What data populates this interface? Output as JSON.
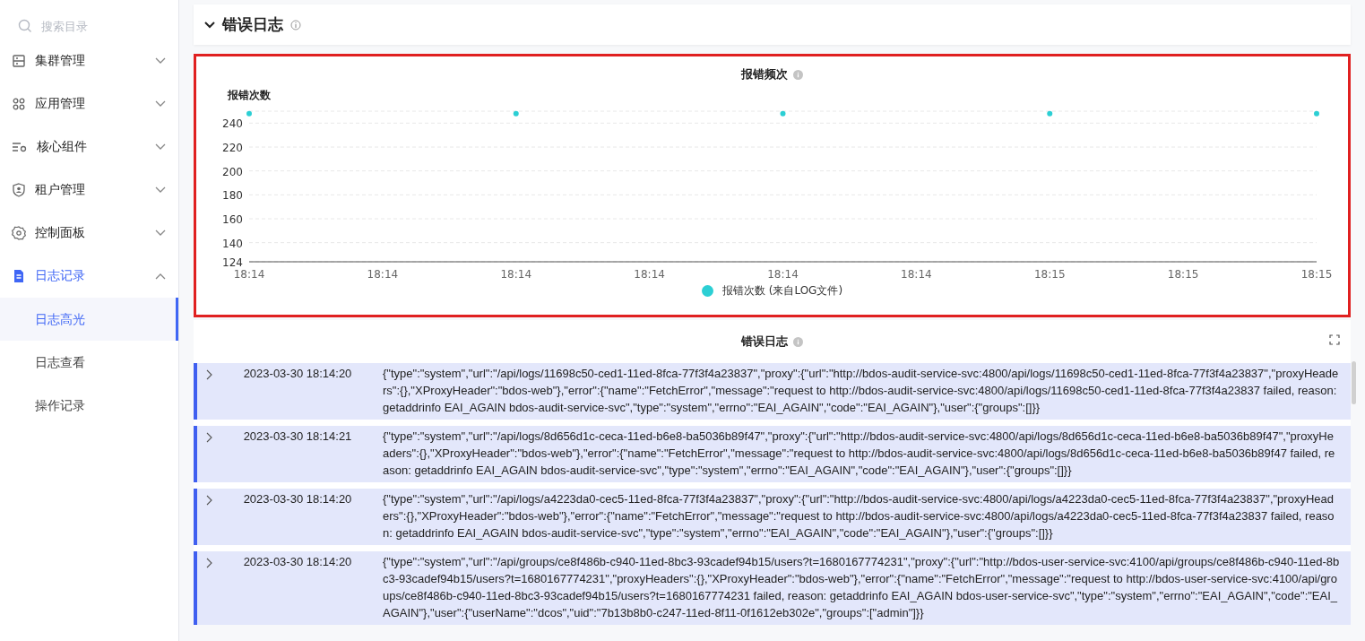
{
  "sidebar": {
    "search": {
      "placeholder": "搜索目录"
    },
    "items": [
      {
        "label": "集群管理",
        "expanded": false
      },
      {
        "label": "应用管理",
        "expanded": false
      },
      {
        "label": "核心组件",
        "expanded": false
      },
      {
        "label": "租户管理",
        "expanded": false
      },
      {
        "label": "控制面板",
        "expanded": false
      },
      {
        "label": "日志记录",
        "expanded": true,
        "children": [
          {
            "label": "日志高光",
            "selected": true
          },
          {
            "label": "日志查看",
            "selected": false
          },
          {
            "label": "操作记录",
            "selected": false
          }
        ]
      }
    ]
  },
  "section": {
    "title": "错误日志",
    "expanded": true
  },
  "chart_panel": {
    "title": "报错频次",
    "chart_data": {
      "type": "scatter",
      "grid": true,
      "ylabel": "报错次数",
      "categories": [
        "18:14",
        "18:14",
        "18:14",
        "18:14",
        "18:14",
        "18:14",
        "18:15",
        "18:15",
        "18:15"
      ],
      "ylim": [
        124,
        250
      ],
      "yticks": [
        124,
        140,
        160,
        180,
        200,
        220,
        240
      ],
      "series": [
        {
          "name": "报错次数 (来自LOG文件)",
          "color": "#2ccfd4",
          "values": [
            248,
            null,
            248,
            null,
            248,
            null,
            248,
            null,
            248
          ]
        }
      ]
    }
  },
  "log_panel": {
    "title": "错误日志",
    "rows": [
      {
        "expanded": false,
        "time": "2023-03-30 18:14:20",
        "message": "{\"type\":\"system\",\"url\":\"/api/logs/11698c50-ced1-11ed-8fca-77f3f4a23837\",\"proxy\":{\"url\":\"http://bdos-audit-service-svc:4800/api/logs/11698c50-ced1-11ed-8fca-77f3f4a23837\",\"proxyHeaders\":{},\"XProxyHeader\":\"bdos-web\"},\"error\":{\"name\":\"FetchError\",\"message\":\"request to http://bdos-audit-service-svc:4800/api/logs/11698c50-ced1-11ed-8fca-77f3f4a23837 failed, reason: getaddrinfo EAI_AGAIN bdos-audit-service-svc\",\"type\":\"system\",\"errno\":\"EAI_AGAIN\",\"code\":\"EAI_AGAIN\"},\"user\":{\"groups\":[]}}"
      },
      {
        "expanded": false,
        "time": "2023-03-30 18:14:21",
        "message": "{\"type\":\"system\",\"url\":\"/api/logs/8d656d1c-ceca-11ed-b6e8-ba5036b89f47\",\"proxy\":{\"url\":\"http://bdos-audit-service-svc:4800/api/logs/8d656d1c-ceca-11ed-b6e8-ba5036b89f47\",\"proxyHeaders\":{},\"XProxyHeader\":\"bdos-web\"},\"error\":{\"name\":\"FetchError\",\"message\":\"request to http://bdos-audit-service-svc:4800/api/logs/8d656d1c-ceca-11ed-b6e8-ba5036b89f47 failed, reason: getaddrinfo EAI_AGAIN bdos-audit-service-svc\",\"type\":\"system\",\"errno\":\"EAI_AGAIN\",\"code\":\"EAI_AGAIN\"},\"user\":{\"groups\":[]}}"
      },
      {
        "expanded": false,
        "time": "2023-03-30 18:14:20",
        "message": "{\"type\":\"system\",\"url\":\"/api/logs/a4223da0-cec5-11ed-8fca-77f3f4a23837\",\"proxy\":{\"url\":\"http://bdos-audit-service-svc:4800/api/logs/a4223da0-cec5-11ed-8fca-77f3f4a23837\",\"proxyHeaders\":{},\"XProxyHeader\":\"bdos-web\"},\"error\":{\"name\":\"FetchError\",\"message\":\"request to http://bdos-audit-service-svc:4800/api/logs/a4223da0-cec5-11ed-8fca-77f3f4a23837 failed, reason: getaddrinfo EAI_AGAIN bdos-audit-service-svc\",\"type\":\"system\",\"errno\":\"EAI_AGAIN\",\"code\":\"EAI_AGAIN\"},\"user\":{\"groups\":[]}}"
      },
      {
        "expanded": false,
        "time": "2023-03-30 18:14:20",
        "message": "{\"type\":\"system\",\"url\":\"/api/groups/ce8f486b-c940-11ed-8bc3-93cadef94b15/users?t=1680167774231\",\"proxy\":{\"url\":\"http://bdos-user-service-svc:4100/api/groups/ce8f486b-c940-11ed-8bc3-93cadef94b15/users?t=1680167774231\",\"proxyHeaders\":{},\"XProxyHeader\":\"bdos-web\"},\"error\":{\"name\":\"FetchError\",\"message\":\"request to http://bdos-user-service-svc:4100/api/groups/ce8f486b-c940-11ed-8bc3-93cadef94b15/users?t=1680167774231 failed, reason: getaddrinfo EAI_AGAIN bdos-user-service-svc\",\"type\":\"system\",\"errno\":\"EAI_AGAIN\",\"code\":\"EAI_AGAIN\"},\"user\":{\"userName\":\"dcos\",\"uid\":\"7b13b8b0-c247-11ed-8f11-0f1612eb302e\",\"groups\":[\"admin\"]}}"
      }
    ]
  }
}
